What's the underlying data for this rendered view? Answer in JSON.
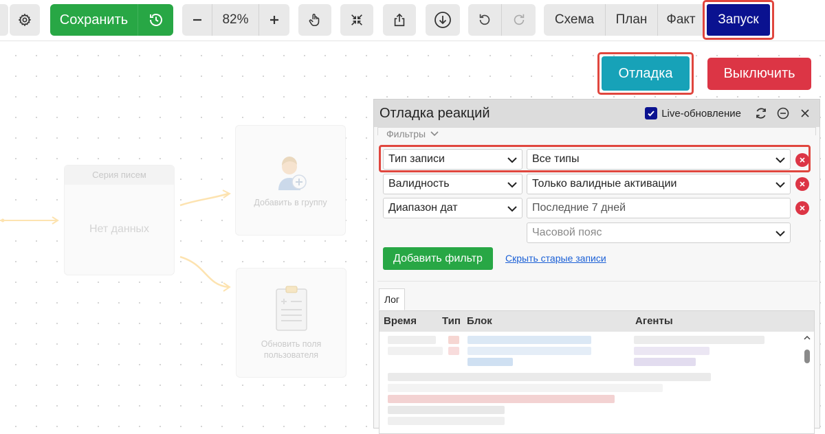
{
  "toolbar": {
    "save_label": "Сохранить",
    "zoom_value": "82%",
    "modes": {
      "schema": "Схема",
      "plan": "План",
      "fact": "Факт",
      "launch": "Запуск"
    }
  },
  "actions": {
    "debug_label": "Отладка",
    "off_label": "Выключить"
  },
  "canvas": {
    "series_title": "Серия писем",
    "series_body": "Нет данных",
    "group_label": "Добавить в группу",
    "update_label": "Обновить поля пользователя"
  },
  "panel": {
    "title": "Отладка реакций",
    "live_label": "Live-обновление",
    "live_checked": true,
    "filters_label": "Фильтры",
    "filters": [
      {
        "field": "Тип записи",
        "value": "Все типы",
        "value_is_placeholder": false
      },
      {
        "field": "Валидность",
        "value": "Только валидные активации",
        "value_is_placeholder": false
      },
      {
        "field": "Диапазон дат",
        "value": "Последние 7 дней",
        "extra_placeholder": "Часовой пояс"
      }
    ],
    "add_filter_label": "Добавить фильтр",
    "hide_old_label": "Скрыть старые записи",
    "log_tab_label": "Лог",
    "log_columns": {
      "time": "Время",
      "type": "Тип",
      "block": "Блок",
      "agents": "Агенты"
    }
  },
  "colors": {
    "save_green": "#28a745",
    "launch_navy": "#0a1290",
    "debug_teal": "#17a2b8",
    "off_red": "#dc3545",
    "highlight_red": "#e0463e"
  }
}
